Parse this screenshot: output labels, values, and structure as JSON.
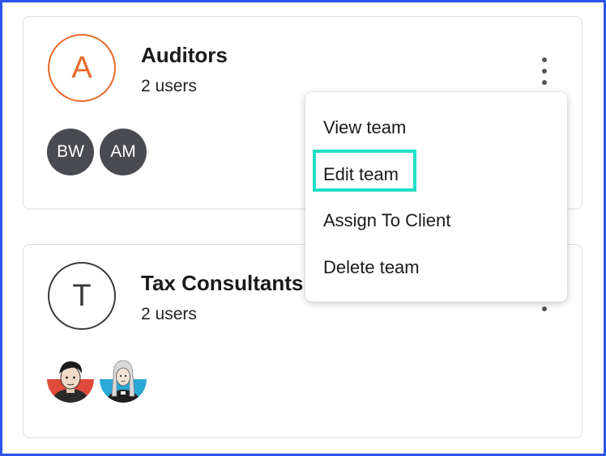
{
  "teams": [
    {
      "initial": "A",
      "name": "Auditors",
      "count": "2 users",
      "accent": "#e8692a",
      "members": [
        "BW",
        "AM"
      ]
    },
    {
      "initial": "T",
      "name": "Tax Consultants",
      "count": "2 users",
      "accent": "#3a3a3a",
      "members": [
        "photo-avatar-male",
        "photo-avatar-female"
      ]
    }
  ],
  "menu": {
    "items": [
      "View team",
      "Edit team",
      "Assign To Client",
      "Delete team"
    ],
    "highlighted_index": 1,
    "highlight_color": "#21e0c5"
  },
  "icons": [
    "more-vertical-icon"
  ],
  "colors": {
    "frame_border": "#2f56e6",
    "member_bg": "#4a4b50"
  }
}
